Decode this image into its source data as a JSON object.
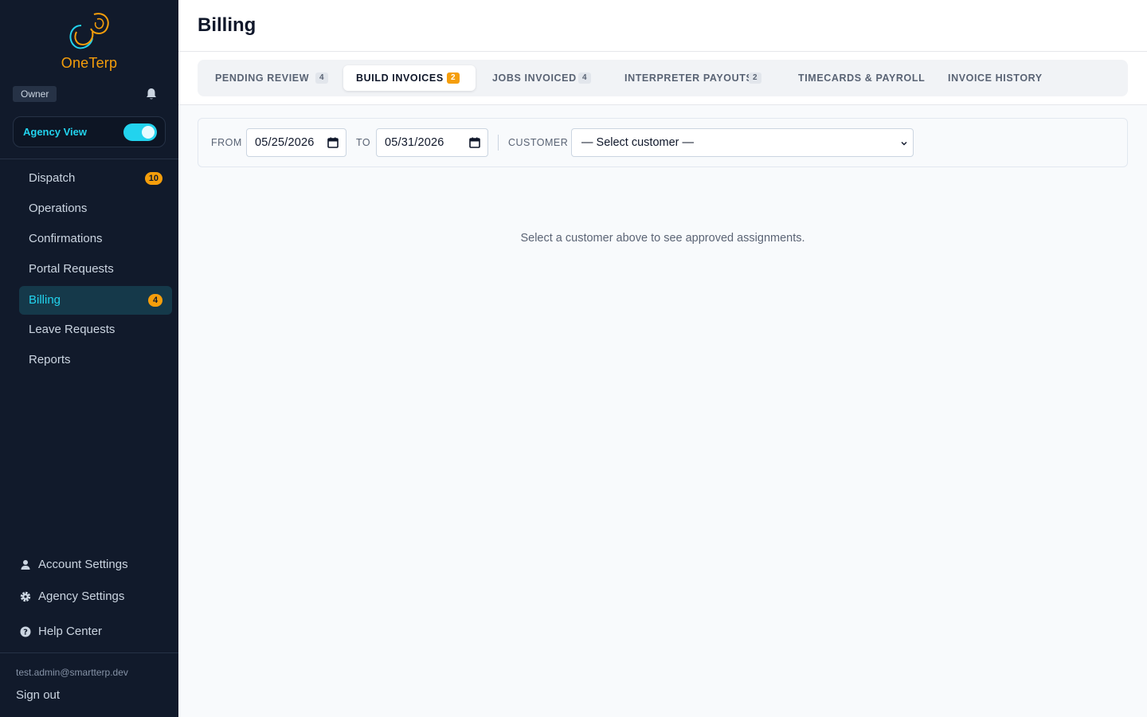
{
  "brand": {
    "name": "OneTerp"
  },
  "sidebar": {
    "role": "Owner",
    "agency_view_label": "Agency View",
    "agency_view_on": true,
    "nav": [
      {
        "label": "Dispatch",
        "badge": "10",
        "active": false
      },
      {
        "label": "Operations",
        "badge": "",
        "active": false
      },
      {
        "label": "Confirmations",
        "badge": "",
        "active": false
      },
      {
        "label": "Portal Requests",
        "badge": "",
        "active": false
      },
      {
        "label": "Billing",
        "badge": "4",
        "active": true
      },
      {
        "label": "Leave Requests",
        "badge": "",
        "active": false
      },
      {
        "label": "Reports",
        "badge": "",
        "active": false
      }
    ],
    "bottom": [
      {
        "label": "Account Settings",
        "icon": "user-icon"
      },
      {
        "label": "Agency Settings",
        "icon": "gear-icon"
      },
      {
        "label": "Help Center",
        "icon": "help-icon"
      }
    ],
    "user_email": "test.admin@smartterp.dev",
    "sign_out": "Sign out"
  },
  "header": {
    "title": "Billing"
  },
  "tabs": [
    {
      "label": "PENDING REVIEW",
      "count": "4",
      "active": false
    },
    {
      "label": "BUILD INVOICES",
      "count": "2",
      "active": true
    },
    {
      "label": "JOBS INVOICED",
      "count": "4",
      "active": false
    },
    {
      "label": "INTERPRETER PAYOUTS",
      "count": "2",
      "active": false
    },
    {
      "label": "TIMECARDS & PAYROLL",
      "count": "",
      "active": false
    },
    {
      "label": "INVOICE HISTORY",
      "count": "",
      "active": false
    }
  ],
  "filters": {
    "from_label": "FROM",
    "from_value": "05/25/2026",
    "to_label": "TO",
    "to_value": "05/31/2026",
    "customer_label": "CUSTOMER",
    "customer_value": "— Select customer —"
  },
  "empty_message": "Select a customer above to see approved assignments.",
  "colors": {
    "sidebar_bg": "#111a2b",
    "accent": "#22d3ee",
    "badge": "#f59e0b",
    "page_bg": "#f8fafc"
  }
}
